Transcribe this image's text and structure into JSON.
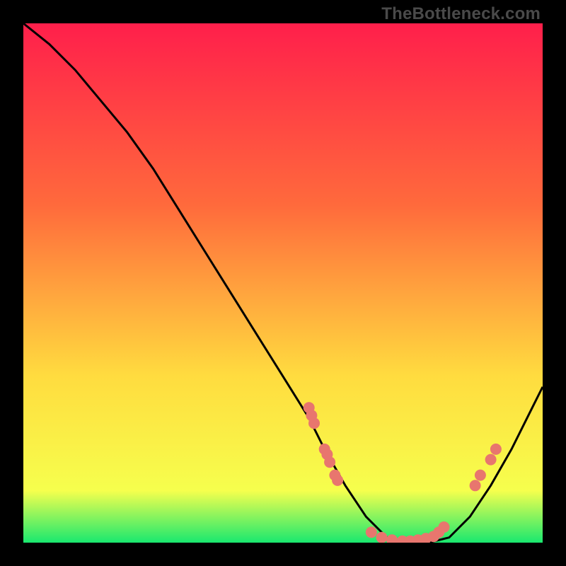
{
  "watermark": "TheBottleneck.com",
  "colors": {
    "grad_top": "#ff1f4b",
    "grad_mid1": "#ff6a3c",
    "grad_mid2": "#ffdc3f",
    "grad_bot_y": "#f6ff4d",
    "grad_bot_g": "#19e86f",
    "curve": "#000000",
    "dot": "#e8766e"
  },
  "chart_data": {
    "type": "line",
    "title": "",
    "xlabel": "",
    "ylabel": "",
    "xlim": [
      0,
      100
    ],
    "ylim": [
      0,
      100
    ],
    "series": [
      {
        "name": "bottleneck-curve",
        "x": [
          0,
          5,
          10,
          15,
          20,
          25,
          30,
          35,
          40,
          45,
          50,
          55,
          58,
          62,
          66,
          70,
          74,
          78,
          82,
          86,
          90,
          94,
          98,
          100
        ],
        "y": [
          100,
          96,
          91,
          85,
          79,
          72,
          64,
          56,
          48,
          40,
          32,
          24,
          18,
          11,
          5,
          1,
          0,
          0,
          1,
          5,
          11,
          18,
          26,
          30
        ]
      }
    ],
    "dots": [
      {
        "x": 55,
        "y": 26
      },
      {
        "x": 55.5,
        "y": 24.5
      },
      {
        "x": 56,
        "y": 23
      },
      {
        "x": 58,
        "y": 18
      },
      {
        "x": 58.5,
        "y": 17
      },
      {
        "x": 59,
        "y": 15.5
      },
      {
        "x": 60,
        "y": 13
      },
      {
        "x": 60.5,
        "y": 12
      },
      {
        "x": 67,
        "y": 2
      },
      {
        "x": 69,
        "y": 1
      },
      {
        "x": 71,
        "y": 0.5
      },
      {
        "x": 73,
        "y": 0.3
      },
      {
        "x": 74.5,
        "y": 0.3
      },
      {
        "x": 76,
        "y": 0.5
      },
      {
        "x": 77.5,
        "y": 0.8
      },
      {
        "x": 79,
        "y": 1.2
      },
      {
        "x": 80,
        "y": 2
      },
      {
        "x": 81,
        "y": 3
      },
      {
        "x": 87,
        "y": 11
      },
      {
        "x": 88,
        "y": 13
      },
      {
        "x": 90,
        "y": 16
      },
      {
        "x": 91,
        "y": 18
      }
    ]
  }
}
